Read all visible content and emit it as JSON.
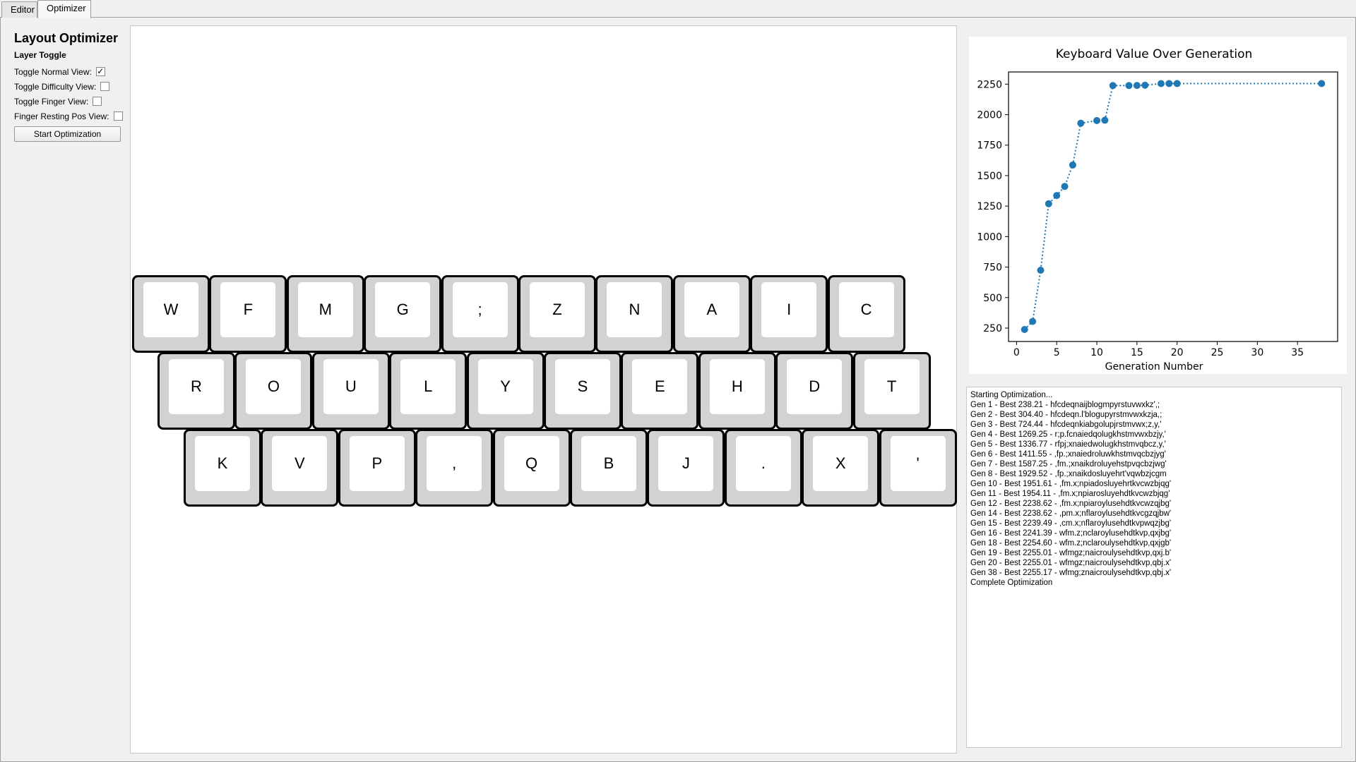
{
  "tabs": [
    {
      "label": "Editor",
      "active": false
    },
    {
      "label": "Optimizer",
      "active": true
    }
  ],
  "sidebar": {
    "title": "Layout Optimizer",
    "section": "Layer Toggle",
    "toggles": [
      {
        "label": "Toggle Normal View:",
        "checked": true,
        "mark": "✓"
      },
      {
        "label": "Toggle Difficulty View:",
        "checked": false,
        "mark": ""
      },
      {
        "label": "Toggle Finger View:",
        "checked": false,
        "mark": ""
      },
      {
        "label": "Finger Resting Pos View:",
        "checked": false,
        "mark": ""
      }
    ],
    "start_button": "Start Optimization"
  },
  "keyboard": {
    "rows": [
      [
        "W",
        "F",
        "M",
        "G",
        ";",
        "Z",
        "N",
        "A",
        "I",
        "C"
      ],
      [
        "R",
        "O",
        "U",
        "L",
        "Y",
        "S",
        "E",
        "H",
        "D",
        "T"
      ],
      [
        "K",
        "V",
        "P",
        ",",
        "Q",
        "B",
        "J",
        ".",
        "X",
        "'"
      ]
    ],
    "key_fill": "#d2d2d2",
    "key_face": "#ffffff"
  },
  "chart_data": {
    "type": "line",
    "title": "Keyboard Value Over Generation",
    "xlabel": "Generation Number",
    "ylabel": "",
    "xlim": [
      -1,
      40
    ],
    "ylim": [
      140,
      2350
    ],
    "x_ticks": [
      0,
      5,
      10,
      15,
      20,
      25,
      30,
      35
    ],
    "y_ticks": [
      250,
      500,
      750,
      1000,
      1250,
      1500,
      1750,
      2000,
      2250
    ],
    "line_style": "dotted",
    "color": "#1f77b4",
    "grid": false,
    "series": [
      {
        "x": [
          1,
          2,
          3,
          4,
          5,
          6,
          7,
          8,
          10,
          11,
          12,
          14,
          15,
          16,
          18,
          19,
          20,
          38
        ],
        "y": [
          238.21,
          304.4,
          724.44,
          1269.25,
          1336.77,
          1411.55,
          1587.25,
          1929.52,
          1951.61,
          1954.11,
          2238.62,
          2238.62,
          2239.49,
          2241.39,
          2254.6,
          2255.01,
          2255.01,
          2255.17
        ]
      }
    ]
  },
  "log": {
    "lines": [
      "Starting Optimization...",
      "Gen 1 - Best 238.21 - hfcdeqnaijblogmpyrstuvwxkz',;",
      "Gen 2 - Best 304.40 - hfcdeqn.l'blogupyrstmvwxkzja,;",
      "Gen 3 - Best 724.44 - hfcdeqnkiabgolupjrstmvwx;z,y,'",
      "Gen 4 - Best 1269.25 - r;p.fcnaiedqolugkhstmvwxbzjy,'",
      "Gen 5 - Best 1336.77 - rfpj;xnaiedwolugkhstmvqbcz,y,'",
      "Gen 6 - Best 1411.55 - ,fp.;xnaiedroluwkhstmvqcbzjyg'",
      "Gen 7 - Best 1587.25 - ,fm.;xnaikdroluyehstpvqcbzjwg'",
      "Gen 8 - Best 1929.52 - ,fp.;xnaikdosluyehrt'vqwbzjcgm",
      "Gen 10 - Best 1951.61 - ,fm.x;npiadosluyehrtkvcwzbjqg'",
      "Gen 11 - Best 1954.11 - ,fm.x;npiarosluyehdtkvcwzbjqg'",
      "Gen 12 - Best 2238.62 - ,fm.x;npiaroylusehdtkvcwzqjbg'",
      "Gen 14 - Best 2238.62 - ,pm.x;nflaroylusehdtkvcgzqjbw'",
      "Gen 15 - Best 2239.49 - ,cm.x;nflaroylusehdtkvpwqzjbg'",
      "Gen 16 - Best 2241.39 - wfm.z;nclaroylusehdtkvp,qxjbg'",
      "Gen 18 - Best 2254.60 - wfm.z;nclaroulysehdtkvp,qxjgb'",
      "Gen 19 - Best 2255.01 - wfmgz;naicroulysehdtkvp,qxj.b'",
      "Gen 20 - Best 2255.01 - wfmgz;naicroulysehdtkvp,qbj.x'",
      "Gen 38 - Best 2255.17 - wfmg;znaicroulysehdtkvp,qbj.x'",
      "Complete Optimization"
    ]
  }
}
